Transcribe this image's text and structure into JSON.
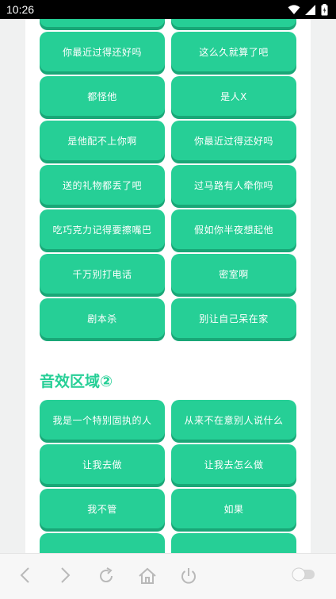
{
  "status_bar": {
    "time": "10:26"
  },
  "sound_grid_1": [
    "",
    "",
    "你最近过得还好吗",
    "这么久就算了吧",
    "都怪他",
    "是人X",
    "是他配不上你啊",
    "你最近过得还好吗",
    "送的礼物都丢了吧",
    "过马路有人牵你吗",
    "吃巧克力记得要擦嘴巴",
    "假如你半夜想起他",
    "千万别打电话",
    "密室啊",
    "剧本杀",
    "别让自己呆在家"
  ],
  "section_2_title": "音效区域②",
  "sound_grid_2": [
    "我是一个特别固执的人",
    "从来不在意别人说什么",
    "让我去做",
    "让我去怎么做",
    "我不管",
    "如果",
    "",
    ""
  ],
  "colors": {
    "accent": "#26cf96",
    "accent_shadow": "#19a777"
  },
  "bottom_nav": [
    "back-icon",
    "forward-icon",
    "refresh-icon",
    "home-icon",
    "power-icon",
    "toggle-switch"
  ]
}
